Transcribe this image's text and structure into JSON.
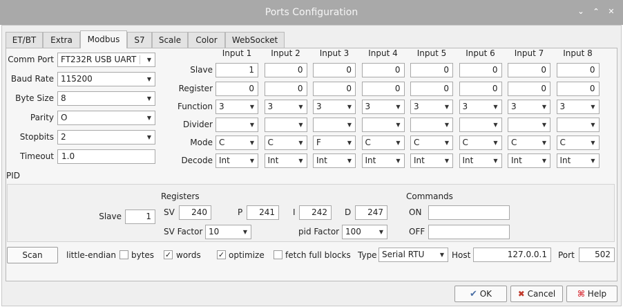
{
  "window": {
    "title": "Ports Configuration",
    "minimize_glyph": "⌄",
    "maximize_glyph": "⌃",
    "close_glyph": "✕"
  },
  "tabs": [
    "ET/BT",
    "Extra",
    "Modbus",
    "S7",
    "Scale",
    "Color",
    "WebSocket"
  ],
  "active_tab": "Modbus",
  "serial": {
    "comm_port_label": "Comm Port",
    "comm_port": "FT232R USB UART",
    "baud_rate_label": "Baud Rate",
    "baud_rate": "115200",
    "byte_size_label": "Byte Size",
    "byte_size": "8",
    "parity_label": "Parity",
    "parity": "O",
    "stopbits_label": "Stopbits",
    "stopbits": "2",
    "timeout_label": "Timeout",
    "timeout": "1.0"
  },
  "inputs": {
    "row_labels": {
      "slave": "Slave",
      "register": "Register",
      "function": "Function",
      "divider": "Divider",
      "mode": "Mode",
      "decode": "Decode"
    },
    "columns": [
      {
        "header": "Input 1",
        "slave": "1",
        "register": "0",
        "function": "3",
        "divider": "",
        "mode": "C",
        "decode": "Int"
      },
      {
        "header": "Input 2",
        "slave": "0",
        "register": "0",
        "function": "3",
        "divider": "",
        "mode": "C",
        "decode": "Int"
      },
      {
        "header": "Input 3",
        "slave": "0",
        "register": "0",
        "function": "3",
        "divider": "",
        "mode": "F",
        "decode": "Int"
      },
      {
        "header": "Input 4",
        "slave": "0",
        "register": "0",
        "function": "3",
        "divider": "",
        "mode": "C",
        "decode": "Int"
      },
      {
        "header": "Input 5",
        "slave": "0",
        "register": "0",
        "function": "3",
        "divider": "",
        "mode": "C",
        "decode": "Int"
      },
      {
        "header": "Input 6",
        "slave": "0",
        "register": "0",
        "function": "3",
        "divider": "",
        "mode": "C",
        "decode": "Int"
      },
      {
        "header": "Input 7",
        "slave": "0",
        "register": "0",
        "function": "3",
        "divider": "",
        "mode": "C",
        "decode": "Int"
      },
      {
        "header": "Input 8",
        "slave": "0",
        "register": "0",
        "function": "3",
        "divider": "",
        "mode": "C",
        "decode": "Int"
      }
    ]
  },
  "pid": {
    "section_label": "PID",
    "slave_label": "Slave",
    "slave": "1",
    "registers_label": "Registers",
    "sv_label": "SV",
    "sv": "240",
    "p_label": "P",
    "p": "241",
    "i_label": "I",
    "i": "242",
    "d_label": "D",
    "d": "247",
    "sv_factor_label": "SV Factor",
    "sv_factor": "10",
    "pid_factor_label": "pid Factor",
    "pid_factor": "100",
    "commands_label": "Commands",
    "on_label": "ON",
    "on_value": "",
    "off_label": "OFF",
    "off_value": ""
  },
  "bottom": {
    "scan_label": "Scan",
    "little_endian_label": "little-endian",
    "bytes_label": "bytes",
    "bytes_checked": false,
    "words_label": "words",
    "words_checked": true,
    "optimize_label": "optimize",
    "optimize_checked": true,
    "fetch_label": "fetch full blocks",
    "fetch_checked": false,
    "type_label": "Type",
    "type": "Serial RTU",
    "host_label": "Host",
    "host": "127.0.0.1",
    "port_label": "Port",
    "port": "502"
  },
  "buttons": {
    "ok": "OK",
    "cancel": "Cancel",
    "help": "Help"
  },
  "colors": {
    "titlebar": "#a9a9a9",
    "dialog_bg": "#efefef",
    "panel_bg": "#f6f6f6",
    "cancel_icon": "#c0392b",
    "help_icon": "#d9363e",
    "ok_icon": "#4a6fa5"
  }
}
